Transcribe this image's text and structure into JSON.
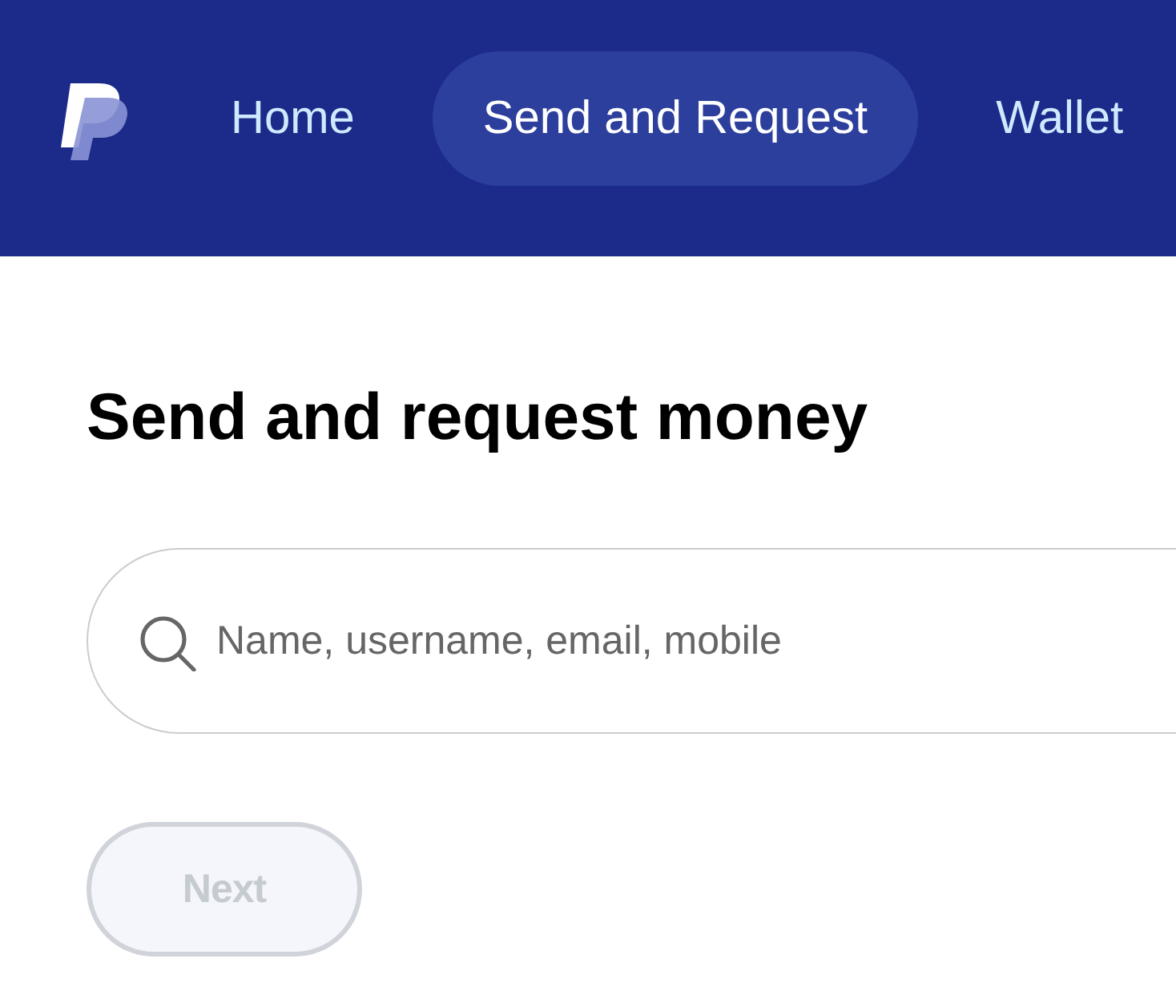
{
  "nav": {
    "items": [
      {
        "label": "Home",
        "selected": false
      },
      {
        "label": "Send and Request",
        "selected": true
      },
      {
        "label": "Wallet",
        "selected": false
      }
    ]
  },
  "heading": "Send and request money",
  "search": {
    "placeholder": "Name, username, email, mobile"
  },
  "next_button": {
    "label": "Next",
    "disabled": true
  }
}
